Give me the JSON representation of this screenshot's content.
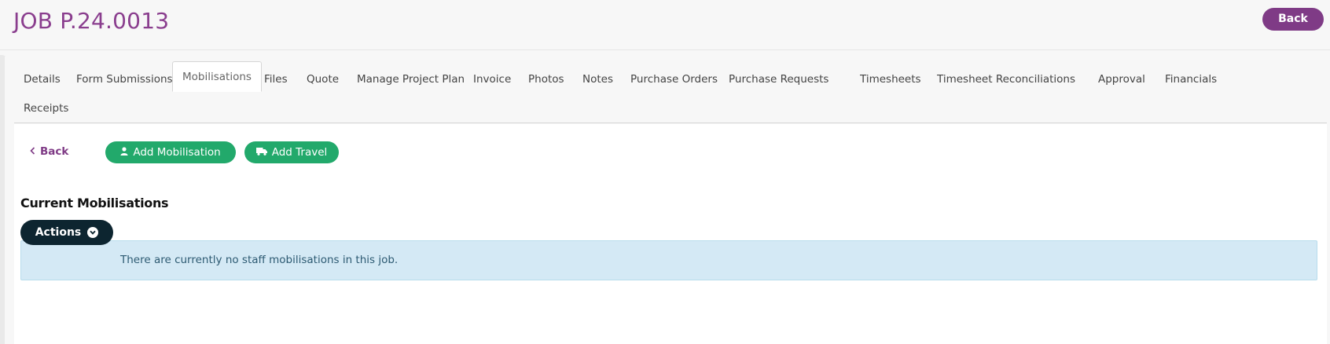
{
  "header": {
    "title": "JOB P.24.0013",
    "back_label": "Back"
  },
  "tabs": [
    {
      "label": "Details",
      "active": false
    },
    {
      "label": "Form Submissions",
      "active": false
    },
    {
      "label": "Mobilisations",
      "active": true
    },
    {
      "label": "Files",
      "active": false
    },
    {
      "label": "Quote",
      "active": false
    },
    {
      "label": "Manage Project Plan",
      "active": false
    },
    {
      "label": "Invoice",
      "active": false
    },
    {
      "label": "Photos",
      "active": false
    },
    {
      "label": "Notes",
      "active": false
    },
    {
      "label": "Purchase Orders",
      "active": false
    },
    {
      "label": "Purchase Requests",
      "active": false
    },
    {
      "label": "Timesheets",
      "active": false
    },
    {
      "label": "Timesheet Reconciliations",
      "active": false
    },
    {
      "label": "Approval",
      "active": false
    },
    {
      "label": "Financials",
      "active": false
    },
    {
      "label": "Receipts",
      "active": false
    }
  ],
  "toolbar": {
    "back_label": "Back",
    "add_mobilisation_label": "Add Mobilisation",
    "add_travel_label": "Add Travel"
  },
  "section": {
    "title": "Current Mobilisations",
    "actions_label": "Actions",
    "empty_message": "There are currently no staff mobilisations in this job."
  },
  "colors": {
    "brand_purple": "#7f3b86",
    "title_purple": "#8a3e8e",
    "success_green": "#22a96b",
    "dark_navy": "#0d2530",
    "info_bg": "#d4e9f5"
  }
}
